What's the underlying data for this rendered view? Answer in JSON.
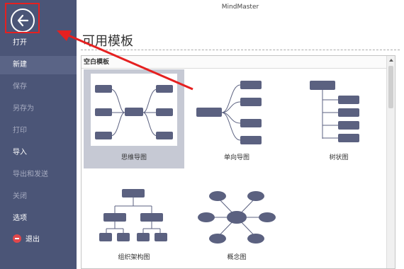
{
  "app": {
    "title": "MindMaster"
  },
  "sidebar": {
    "back_icon": "arrow-left-circle-icon",
    "items": [
      {
        "label": "打开",
        "state": "active"
      },
      {
        "label": "新建",
        "state": "selected"
      },
      {
        "label": "保存",
        "state": "dim"
      },
      {
        "label": "另存为",
        "state": "dim"
      },
      {
        "label": "打印",
        "state": "dim"
      },
      {
        "label": "导入",
        "state": "active"
      },
      {
        "label": "导出和发送",
        "state": "dim"
      },
      {
        "label": "关闭",
        "state": "dim"
      },
      {
        "label": "选项",
        "state": "active"
      },
      {
        "label": "退出",
        "state": "active"
      }
    ]
  },
  "main": {
    "section_title": "可用模板",
    "panel_title": "空白模板",
    "templates": [
      {
        "label": "思维导图"
      },
      {
        "label": "单向导图"
      },
      {
        "label": "树状图"
      },
      {
        "label": "组织架构图"
      },
      {
        "label": "概念图"
      }
    ]
  },
  "colors": {
    "sidebar_bg": "#4b5577",
    "node": "#5b6180",
    "selection": "#c6c9d4",
    "annotation": "#e52020"
  }
}
